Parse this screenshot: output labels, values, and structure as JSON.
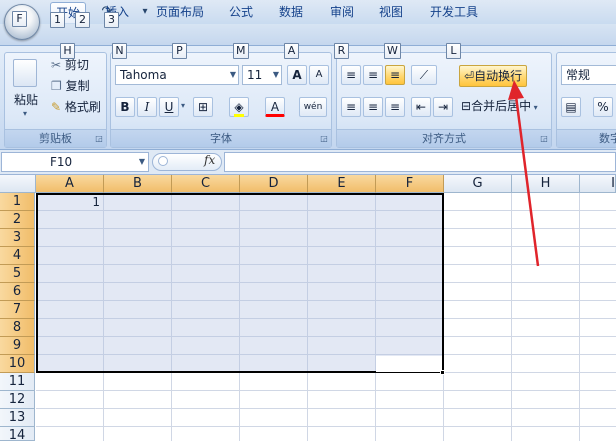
{
  "quick_access": {
    "office_button_keytip": "F",
    "keytips": [
      "1",
      "2",
      "3"
    ],
    "customize_glyph": "▾"
  },
  "tabs": [
    {
      "label": "开始",
      "keytip": "H"
    },
    {
      "label": "插入",
      "keytip": "N"
    },
    {
      "label": "页面布局",
      "keytip": "P"
    },
    {
      "label": "公式",
      "keytip": "M"
    },
    {
      "label": "数据",
      "keytip": "A"
    },
    {
      "label": "审阅",
      "keytip": "R"
    },
    {
      "label": "视图",
      "keytip": "W"
    },
    {
      "label": "开发工具",
      "keytip": "L"
    }
  ],
  "clipboard": {
    "paste": "粘贴",
    "cut": "剪切",
    "copy": "复制",
    "format_painter": "格式刷",
    "label": "剪贴板"
  },
  "font": {
    "name": "Tahoma",
    "size": "11",
    "grow": "A",
    "shrink": "A",
    "bold": "B",
    "italic": "I",
    "underline": "U",
    "font_color_letter": "A",
    "phonetic": "wén",
    "label": "字体"
  },
  "alignment": {
    "wrap_text": "自动换行",
    "merge_center": "合并后居中",
    "label": "对齐方式"
  },
  "number": {
    "format": "常规",
    "percent": "%",
    "label_partial": "数字"
  },
  "formula_bar": {
    "name_box": "F10",
    "fx": "fx",
    "value": ""
  },
  "grid": {
    "columns": [
      "A",
      "B",
      "C",
      "D",
      "E",
      "F",
      "G",
      "H",
      "I"
    ],
    "rows": [
      "1",
      "2",
      "3",
      "4",
      "5",
      "6",
      "7",
      "8",
      "9",
      "10",
      "11",
      "12",
      "13",
      "14"
    ],
    "cells": {
      "A1": "1"
    }
  },
  "colors": {
    "annotation_arrow": "#e0242b",
    "selection_fill": "#b0bee0",
    "selected_header": "#f6c878"
  }
}
